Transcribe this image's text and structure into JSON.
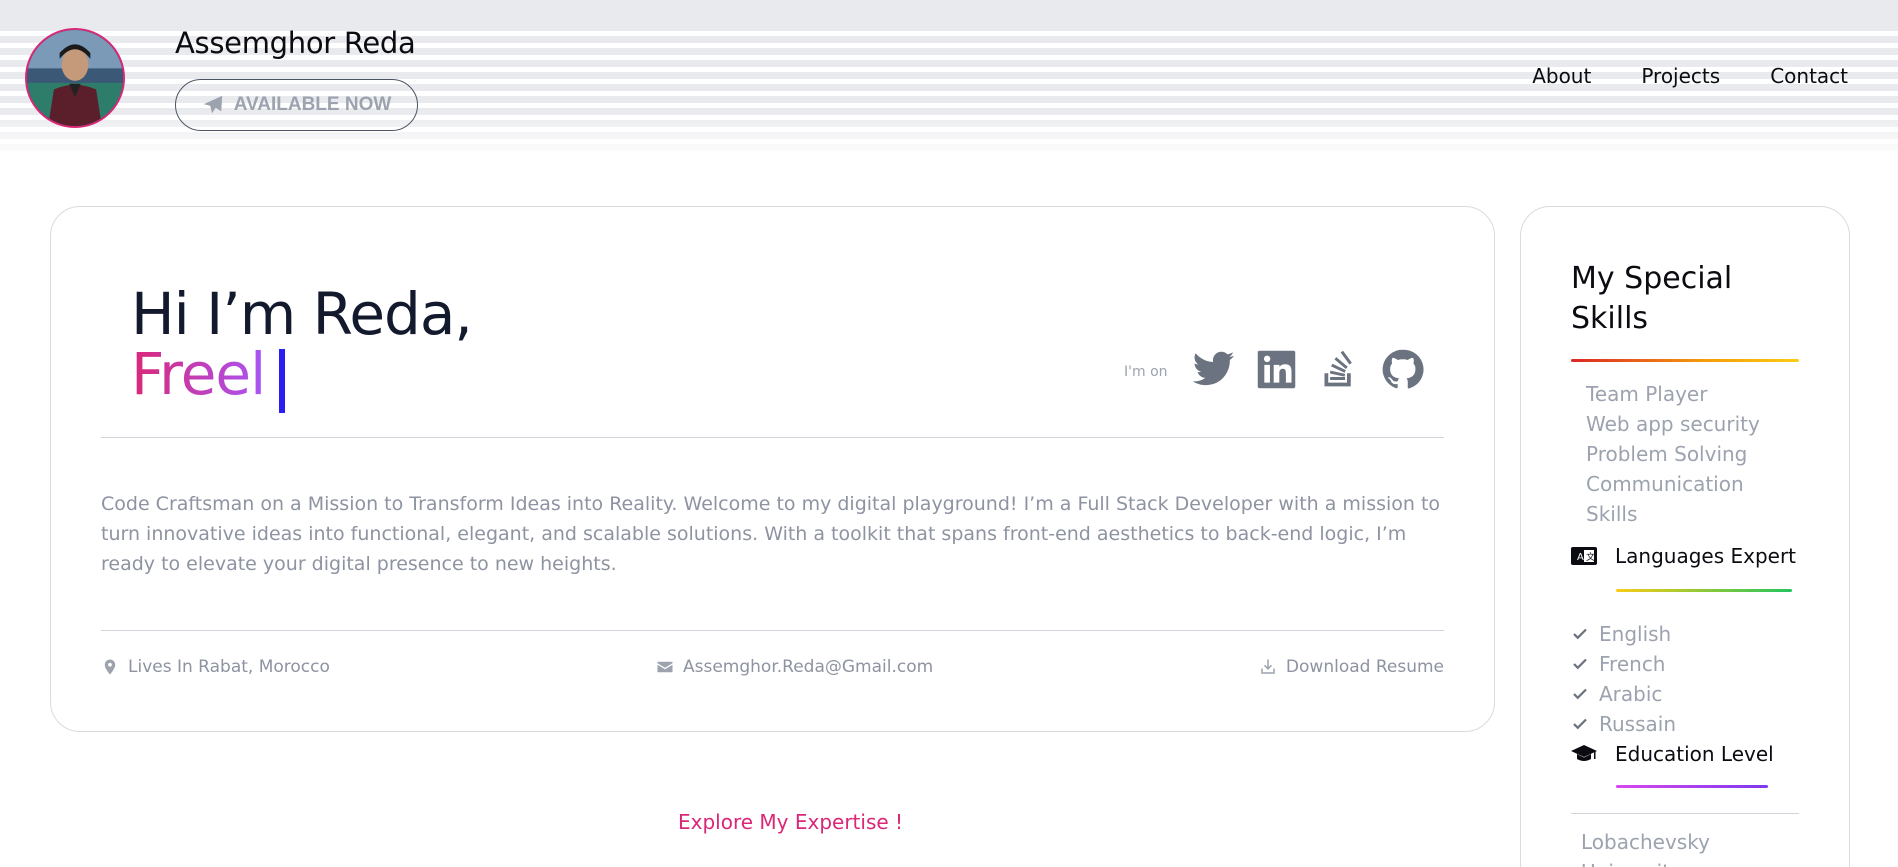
{
  "header": {
    "name": "Assemghor Reda",
    "available_label": "AVAILABLE NOW",
    "nav": [
      "About",
      "Projects",
      "Contact"
    ]
  },
  "hero": {
    "greeting": "Hi I’m Reda,",
    "typed_text": "Freel",
    "im_on_label": "I'm on",
    "socials": [
      "twitter-icon",
      "linkedin-icon",
      "stackoverflow-icon",
      "github-icon"
    ],
    "bio": "Code Craftsman on a Mission to Transform Ideas into Reality. Welcome to my digital playground! I’m a Full Stack Developer with a mission to turn innovative ideas into functional, elegant, and scalable solutions. With a toolkit that spans front-end aesthetics to back-end logic, I’m ready to elevate your digital presence to new heights.",
    "location": "Lives In Rabat, Morocco",
    "email": "Assemghor.Reda@Gmail.com",
    "download": "Download Resume"
  },
  "explore_label": "Explore My Expertise !",
  "skills_panel": {
    "title": "My Special Skills",
    "skills": [
      "Team Player",
      "Web app security",
      "Problem Solving",
      "Communication",
      "Skills"
    ],
    "languages_heading": "Languages Expert",
    "languages": [
      "English",
      "French",
      "Arabic",
      "Russain"
    ],
    "education_heading": "Education Level",
    "education": "Lobachevsky University"
  },
  "colors": {
    "accent_pink": "#db2777",
    "accent_purple": "#a855f7",
    "caret": "#2b1ef0",
    "muted_text": "#8d93a1"
  }
}
